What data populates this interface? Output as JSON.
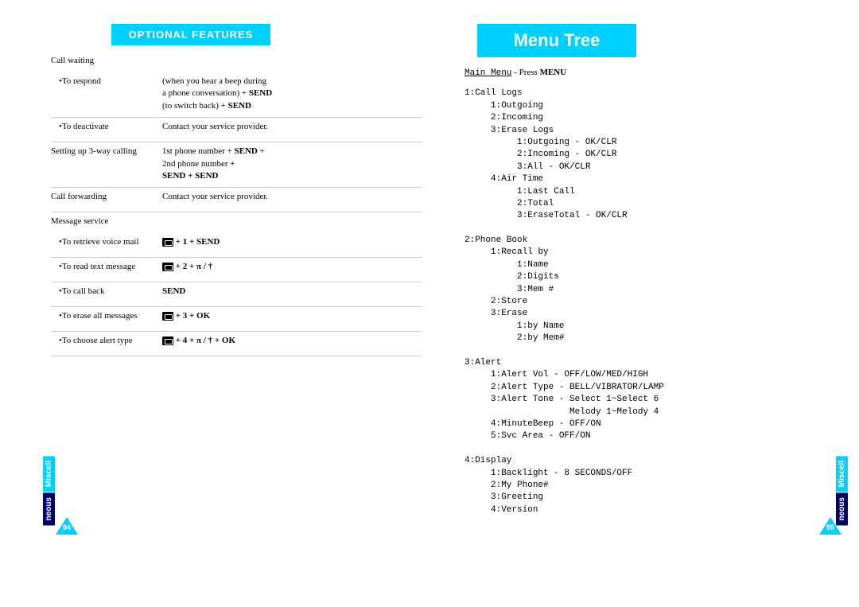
{
  "left": {
    "header": "OPTIONAL FEATURES",
    "sectionTab": {
      "top": "Miscell",
      "bot": "neous"
    },
    "pageNum": "94",
    "callWaiting": "Call waiting",
    "rows": {
      "respond_l": "•To respond",
      "respond_r1": "(when you hear a beep during",
      "respond_r2": "a phone conversation) + ",
      "respond_r2b": "SEND",
      "respond_r3": "(to switch back) + ",
      "respond_r3b": "SEND",
      "deact_l": "•To deactivate",
      "deact_r": "Contact your service provider.",
      "threeway_l": "Setting up 3-way calling",
      "threeway_r1": "1st phone number + ",
      "threeway_r1b": "SEND",
      "threeway_r1c": " +",
      "threeway_r2": "2nd phone number +",
      "threeway_r3": "SEND + SEND",
      "fwd_l": "Call forwarding",
      "fwd_r": "Contact your service provider.",
      "msg_l": "Message service",
      "voice_l": "•To retrieve voice mail",
      "voice_r": " + 1 + SEND",
      "text_l": "•To read text message",
      "text_r": " + 2 + π / †",
      "call_l": "•To call back",
      "call_r": "SEND",
      "erase_l": "•To erase all messages",
      "erase_r": " + 3 + OK",
      "alert_l": "•To choose alert type",
      "alert_r": " + 4 + π / † + OK"
    }
  },
  "right": {
    "header": "Menu Tree",
    "intro_pre": "Main Menu",
    "intro_mid": " - Press ",
    "intro_bold": "MENU",
    "sectionTab": {
      "top": "Miscell",
      "bot": "neous"
    },
    "pageNum": "95",
    "tree": "1:Call Logs\n     1:Outgoing\n     2:Incoming\n     3:Erase Logs\n          1:Outgoing - OK/CLR\n          2:Incoming - OK/CLR\n          3:All - OK/CLR\n     4:Air Time\n          1:Last Call\n          2:Total\n          3:EraseTotal - OK/CLR\n\n2:Phone Book\n     1:Recall by\n          1:Name\n          2:Digits\n          3:Mem #\n     2:Store\n     3:Erase\n          1:by Name\n          2:by Mem#\n\n3:Alert\n     1:Alert Vol - OFF/LOW/MED/HIGH\n     2:Alert Type - BELL/VIBRATOR/LAMP\n     3:Alert Tone - Select 1~Select 6\n                    Melody 1~Melody 4\n     4:MinuteBeep - OFF/ON\n     5:Svc Area - OFF/ON\n\n4:Display\n     1:Backlight - 8 SECONDS/OFF\n     2:My Phone#\n     3:Greeting\n     4:Version"
  }
}
